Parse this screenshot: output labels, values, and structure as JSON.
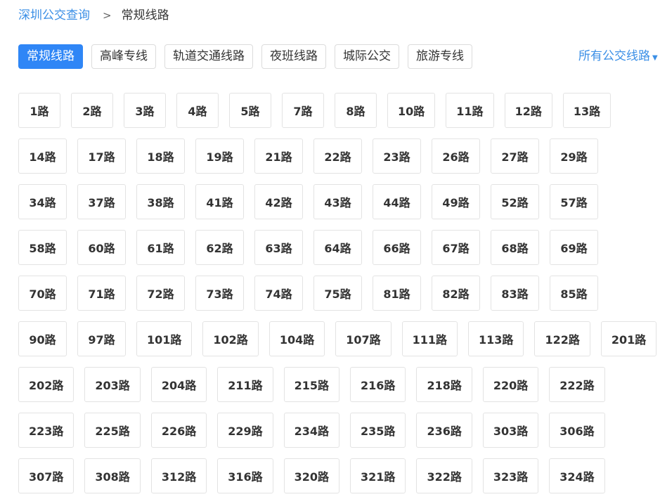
{
  "breadcrumb": {
    "root": "深圳公交查询",
    "separator": ">",
    "current": "常规线路"
  },
  "tabs": [
    {
      "label": "常规线路",
      "active": true
    },
    {
      "label": "高峰专线",
      "active": false
    },
    {
      "label": "轨道交通线路",
      "active": false
    },
    {
      "label": "夜班线路",
      "active": false
    },
    {
      "label": "城际公交",
      "active": false
    },
    {
      "label": "旅游专线",
      "active": false
    }
  ],
  "all_lines_link": "所有公交线路",
  "colors": {
    "accent": "#2f86f6",
    "link": "#3b8fe6",
    "border": "#e3e3e3"
  },
  "routes": [
    [
      "1路",
      "2路",
      "3路",
      "4路",
      "5路",
      "7路",
      "8路",
      "10路",
      "11路",
      "12路",
      "13路"
    ],
    [
      "14路",
      "17路",
      "18路",
      "19路",
      "21路",
      "22路",
      "23路",
      "26路",
      "27路",
      "29路"
    ],
    [
      "34路",
      "37路",
      "38路",
      "41路",
      "42路",
      "43路",
      "44路",
      "49路",
      "52路",
      "57路"
    ],
    [
      "58路",
      "60路",
      "61路",
      "62路",
      "63路",
      "64路",
      "66路",
      "67路",
      "68路",
      "69路"
    ],
    [
      "70路",
      "71路",
      "72路",
      "73路",
      "74路",
      "75路",
      "81路",
      "82路",
      "83路",
      "85路"
    ],
    [
      "90路",
      "97路",
      "101路",
      "102路",
      "104路",
      "107路",
      "111路",
      "113路",
      "122路",
      "201路"
    ],
    [
      "202路",
      "203路",
      "204路",
      "211路",
      "215路",
      "216路",
      "218路",
      "220路",
      "222路"
    ],
    [
      "223路",
      "225路",
      "226路",
      "229路",
      "234路",
      "235路",
      "236路",
      "303路",
      "306路"
    ],
    [
      "307路",
      "308路",
      "312路",
      "316路",
      "320路",
      "321路",
      "322路",
      "323路",
      "324路"
    ]
  ]
}
